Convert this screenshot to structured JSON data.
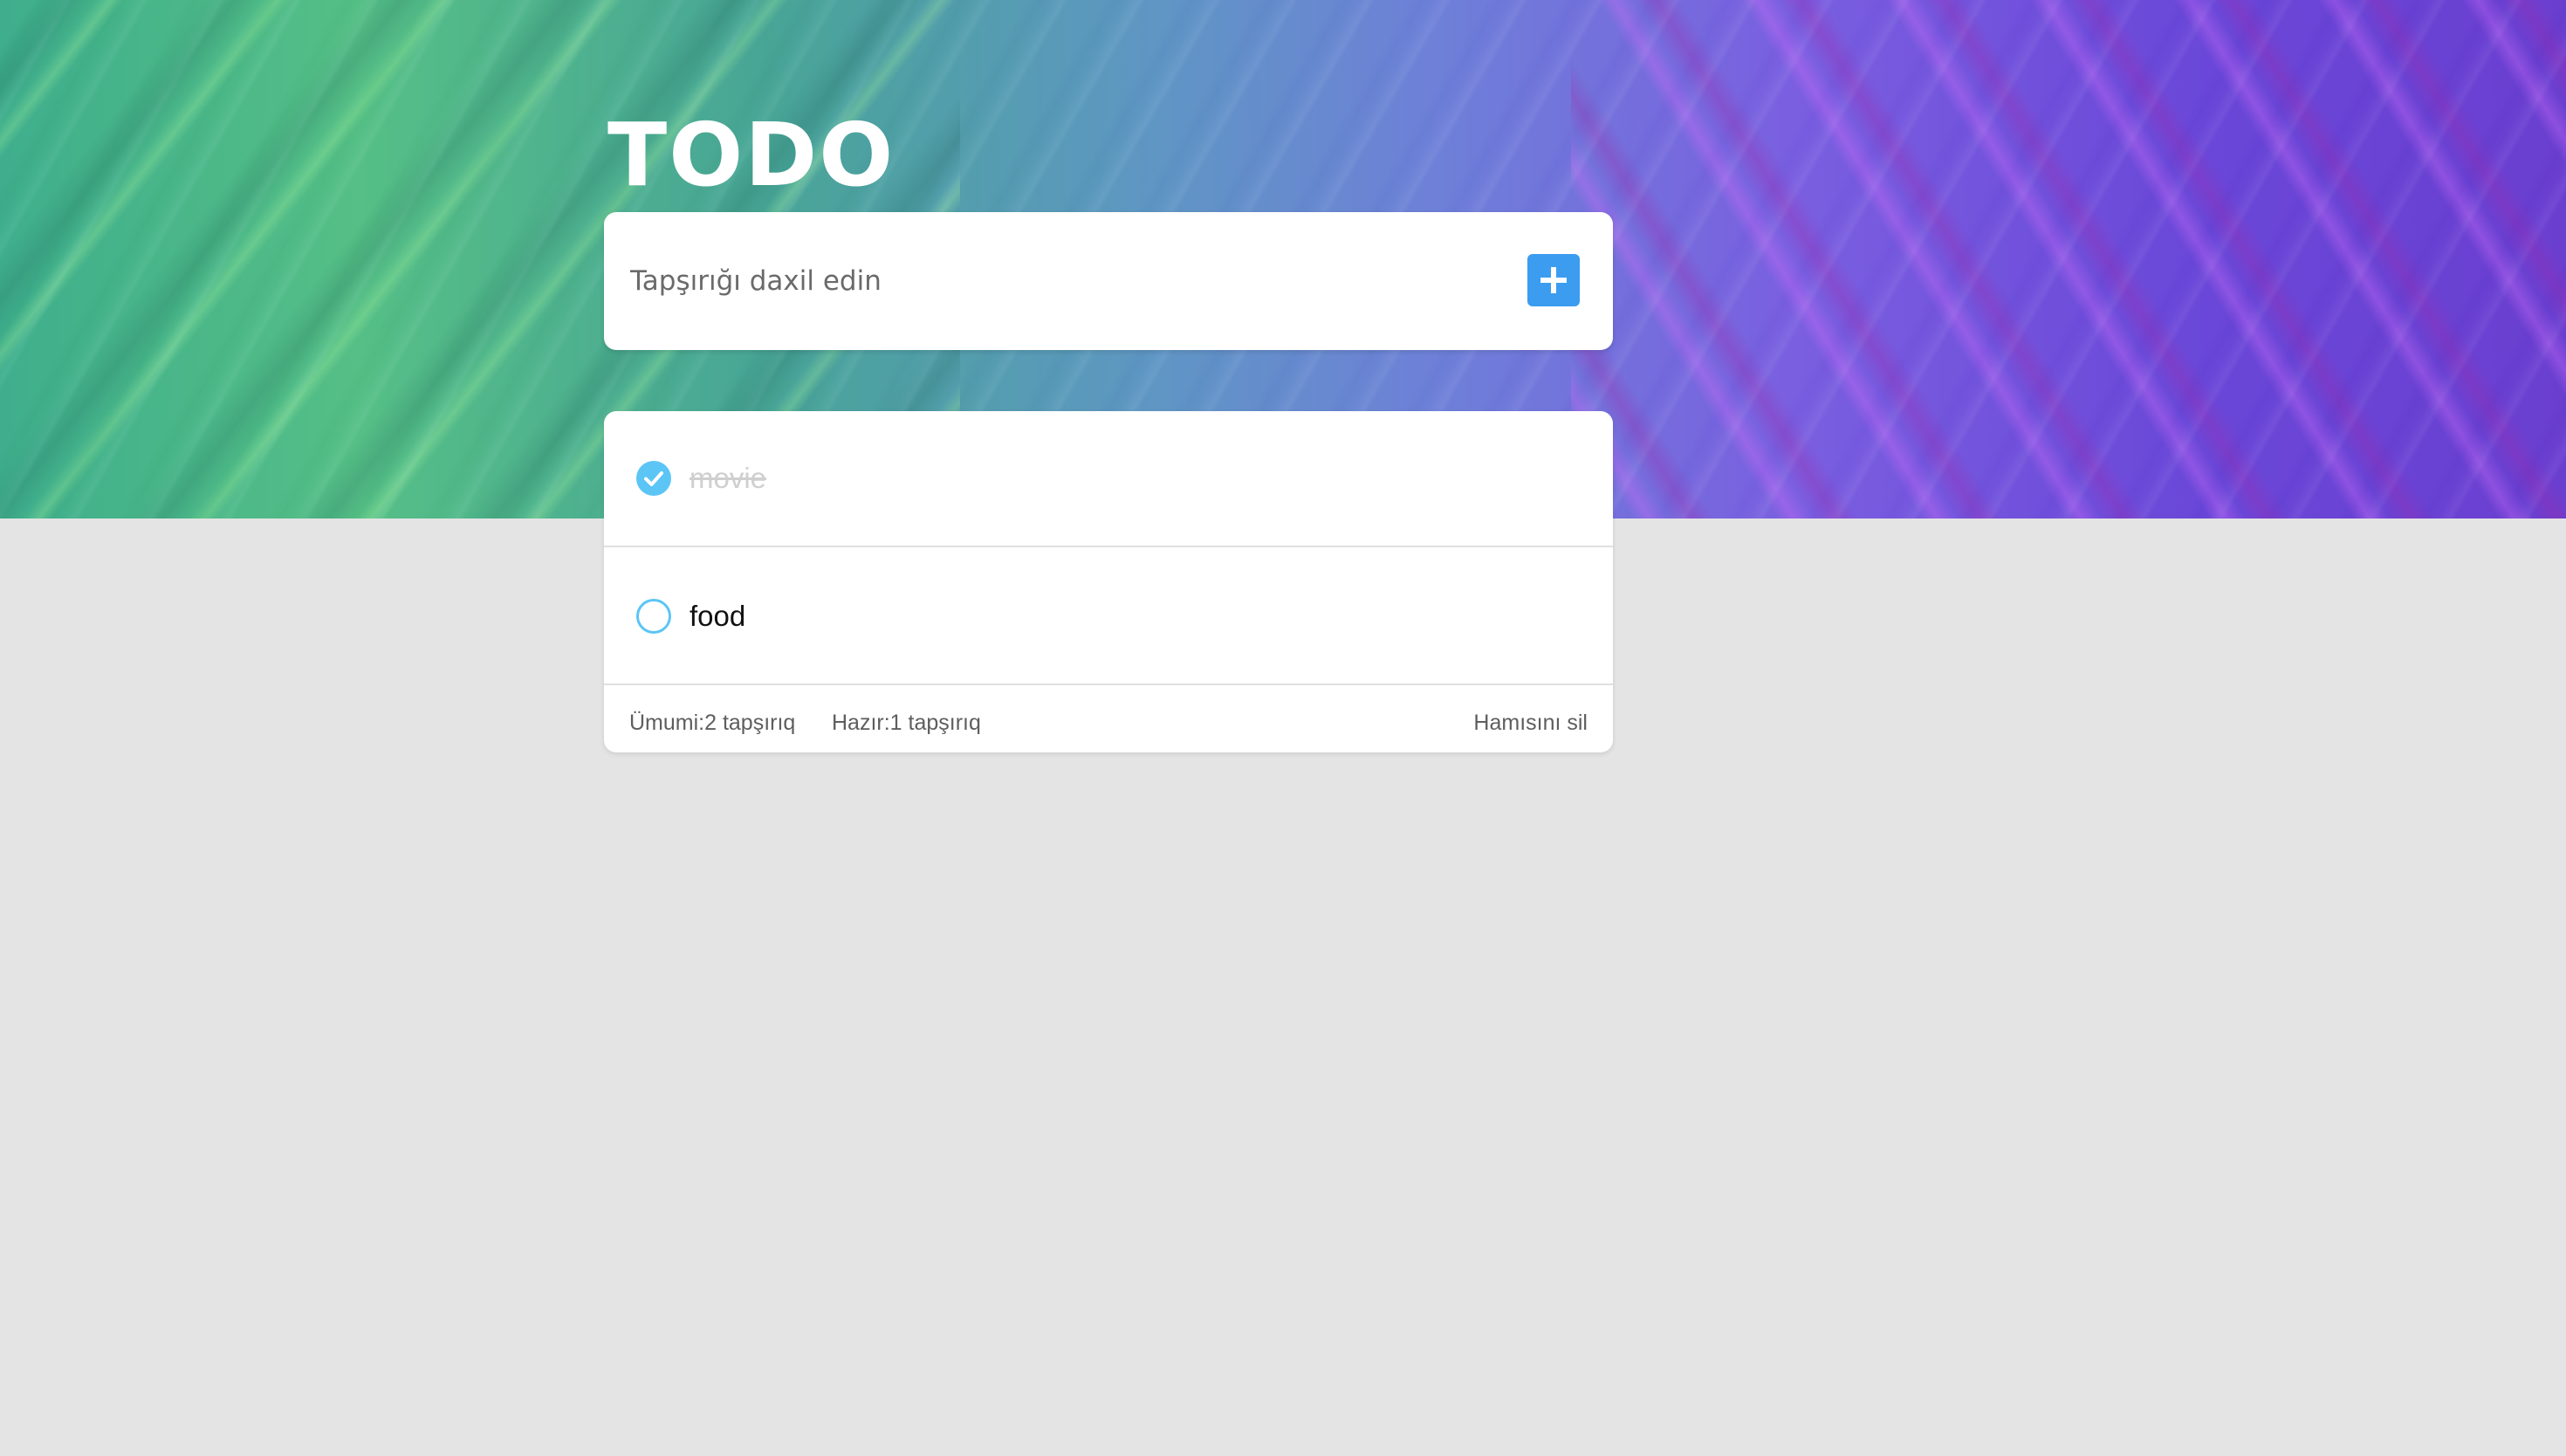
{
  "header": {
    "title": "TODO"
  },
  "input": {
    "placeholder": "Tapşırığı daxil edin",
    "value": "",
    "add_icon": "plus-icon"
  },
  "todos": [
    {
      "text": "movie",
      "completed": true
    },
    {
      "text": "food",
      "completed": false
    }
  ],
  "footer": {
    "total": "Ümumi:2 tapşırıq",
    "done": "Hazır:1 tapşırıq",
    "clear_all": "Hamısını sil"
  },
  "colors": {
    "accent": "#3b9cf0",
    "check": "#5bc5f5",
    "background": "#e4e4e4"
  }
}
